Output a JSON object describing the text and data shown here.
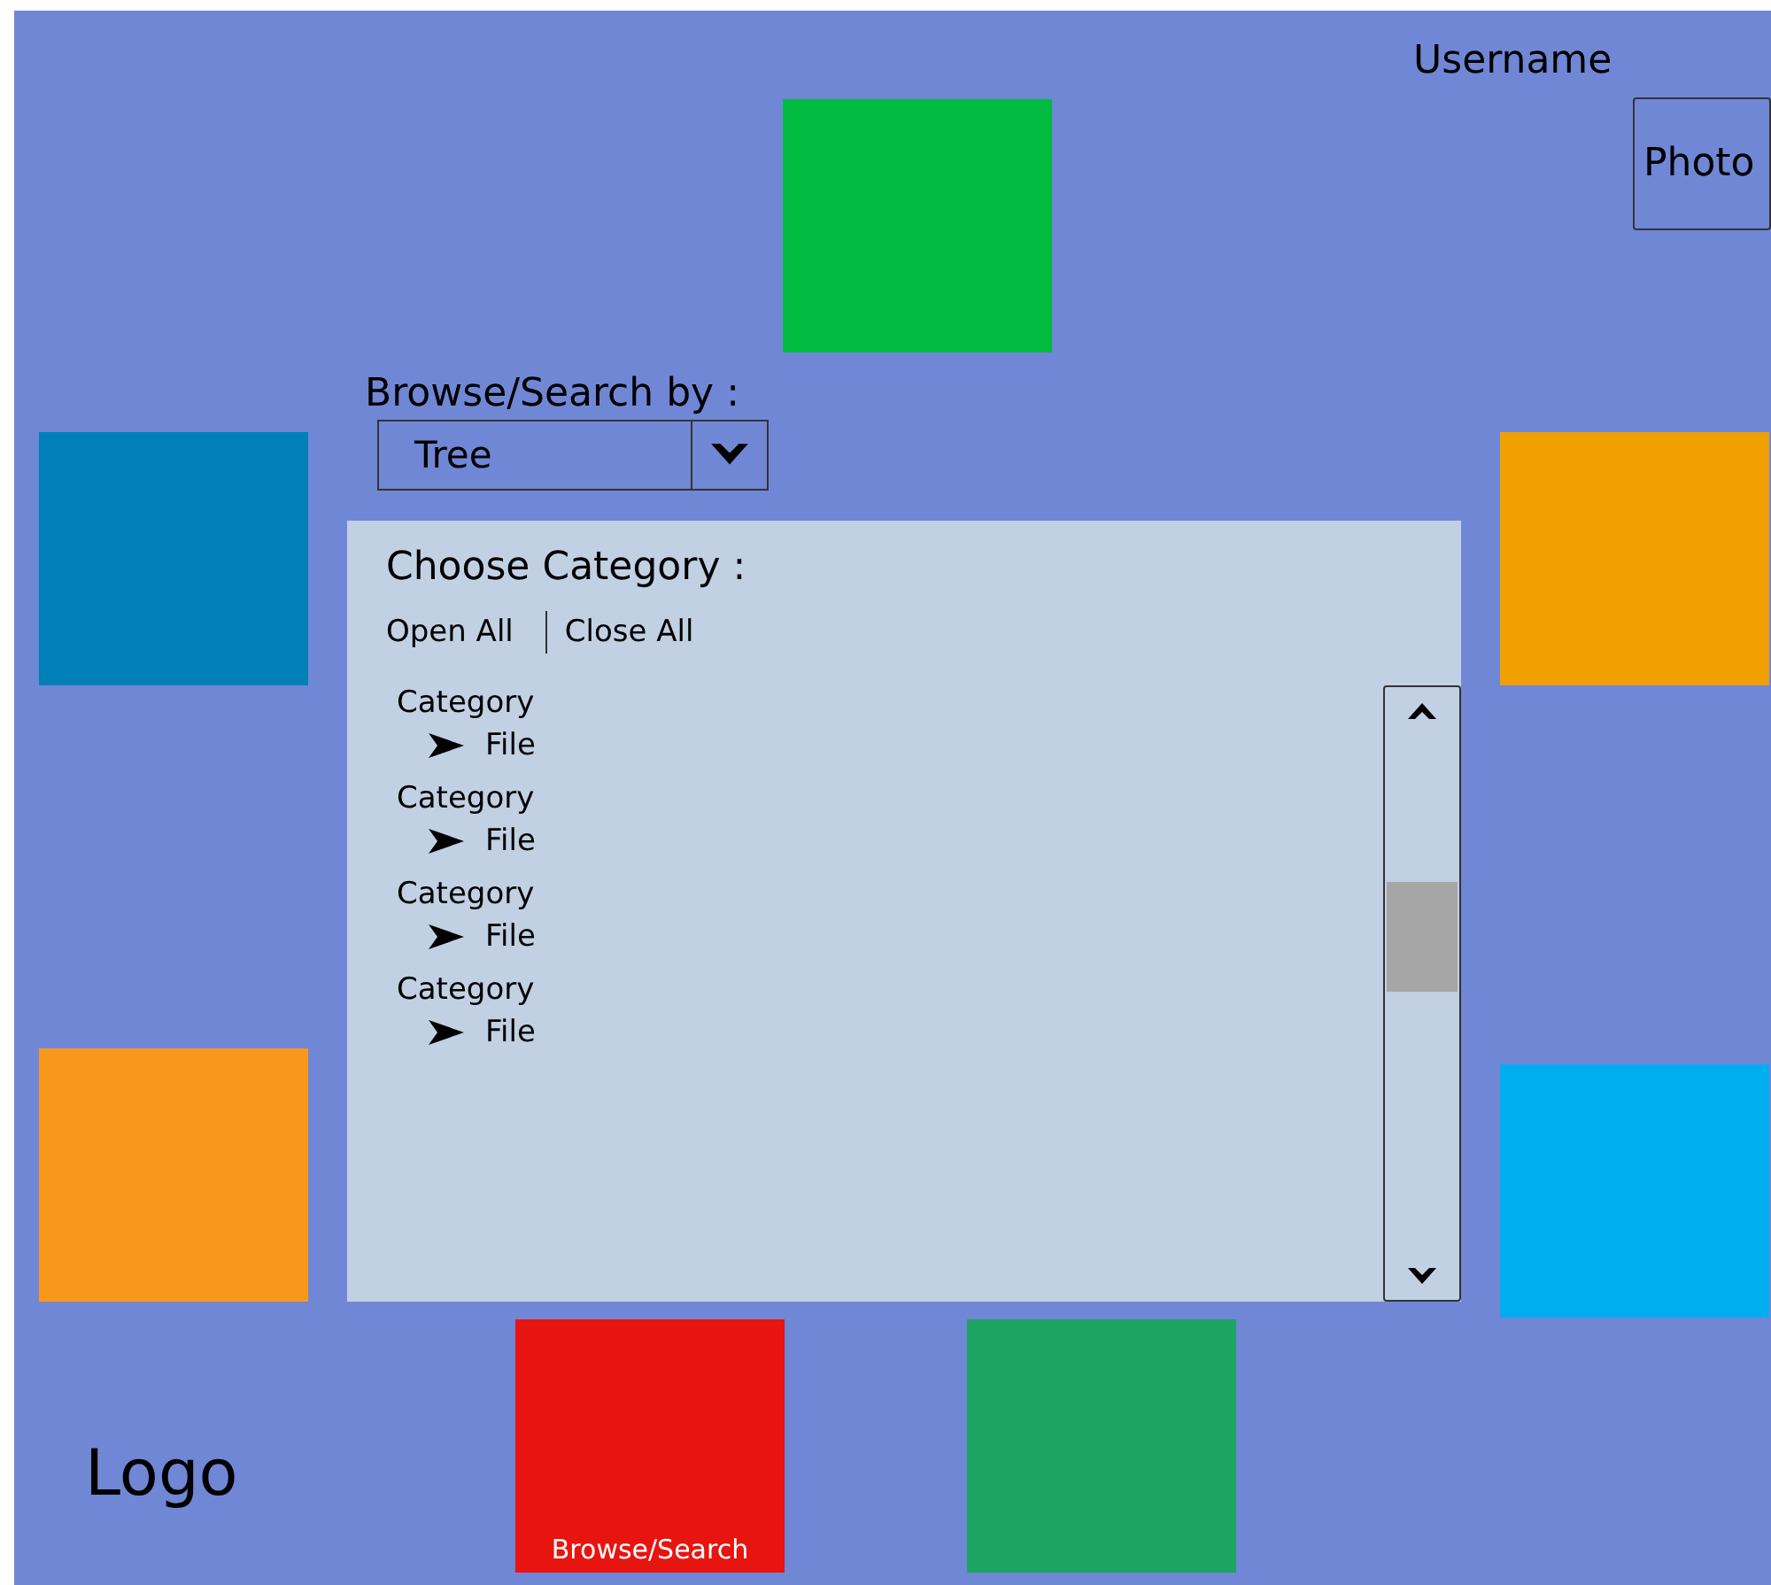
{
  "header": {
    "username": "Username",
    "photo": "Photo"
  },
  "tiles": [
    {
      "color": "#00bb40"
    },
    {
      "color": "#0080b8"
    },
    {
      "color": "#f0a000"
    },
    {
      "color": "#f7981d"
    },
    {
      "color": "#00aeef"
    },
    {
      "color": "#e81410",
      "label": "Browse/Search"
    },
    {
      "color": "#1da462"
    }
  ],
  "browse": {
    "label": "Browse/Search by :",
    "value": "Tree"
  },
  "panel": {
    "title": "Choose Category :",
    "actions": [
      "Open All",
      "Close All"
    ],
    "tree": [
      {
        "label": "Category",
        "children": [
          {
            "label": "File"
          }
        ]
      },
      {
        "label": "Category",
        "children": [
          {
            "label": "File"
          }
        ]
      },
      {
        "label": "Category",
        "children": [
          {
            "label": "File"
          }
        ]
      },
      {
        "label": "Category",
        "children": [
          {
            "label": "File"
          }
        ]
      }
    ]
  },
  "logo": "Logo"
}
